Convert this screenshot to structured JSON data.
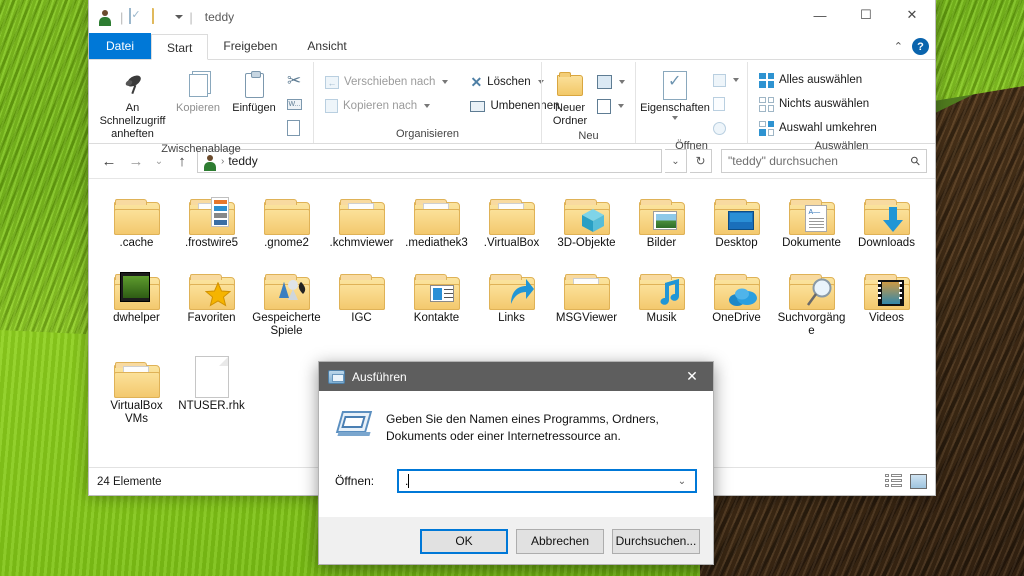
{
  "window": {
    "title": "teddy",
    "quick_access": [
      "user-account-icon",
      "properties-icon",
      "new-folder-icon",
      "customize-caret"
    ],
    "controls": {
      "minimize": "—",
      "maximize": "☐",
      "close": "✕",
      "collapse_ribbon": "⌃",
      "help": "?"
    }
  },
  "ribbon": {
    "tabs": [
      {
        "label": "Datei",
        "type": "file"
      },
      {
        "label": "Start",
        "type": "active"
      },
      {
        "label": "Freigeben",
        "type": "normal"
      },
      {
        "label": "Ansicht",
        "type": "normal"
      }
    ],
    "groups": [
      {
        "label": "Zwischenablage",
        "big": [
          {
            "label": "An Schnellzugriff\nanheften",
            "icon": "pin-icon",
            "dim": false
          },
          {
            "label": "Kopieren",
            "icon": "copy-icon",
            "dim": true
          },
          {
            "label": "Einfügen",
            "icon": "paste-icon",
            "dim": false
          }
        ],
        "small": [
          {
            "label": "",
            "icon": "cut-icon"
          },
          {
            "label": "",
            "icon": "copy-path-icon"
          },
          {
            "label": "",
            "icon": "paste-shortcut-icon"
          }
        ]
      },
      {
        "label": "Organisieren",
        "small": [
          {
            "label": "Verschieben nach",
            "icon": "move-to-icon",
            "dim": true,
            "caret": true
          },
          {
            "label": "Kopieren nach",
            "icon": "copy-to-icon",
            "dim": true,
            "caret": true
          },
          {
            "label": "Löschen",
            "icon": "delete-icon",
            "dim": false,
            "caret": true
          },
          {
            "label": "Umbenennen",
            "icon": "rename-icon",
            "dim": false,
            "caret": false
          }
        ]
      },
      {
        "label": "Neu",
        "big": [
          {
            "label": "Neuer\nOrdner",
            "icon": "new-folder-icon",
            "dim": false
          }
        ],
        "small": [
          {
            "label": "",
            "icon": "new-item-icon",
            "caret": true
          },
          {
            "label": "",
            "icon": "easy-access-icon",
            "caret": true
          }
        ]
      },
      {
        "label": "Öffnen",
        "big": [
          {
            "label": "Eigenschaften",
            "icon": "properties-icon",
            "dim": false,
            "caret": true
          }
        ],
        "small": [
          {
            "label": "",
            "icon": "open-with-icon",
            "caret": true
          },
          {
            "label": "",
            "icon": "edit-icon"
          },
          {
            "label": "",
            "icon": "history-icon"
          }
        ]
      },
      {
        "label": "Auswählen",
        "small": [
          {
            "label": "Alles auswählen",
            "icon": "select-all-icon",
            "dim": false
          },
          {
            "label": "Nichts auswählen",
            "icon": "select-none-icon",
            "dim": false
          },
          {
            "label": "Auswahl umkehren",
            "icon": "invert-selection-icon",
            "dim": false
          }
        ]
      }
    ]
  },
  "addressbar": {
    "back": "←",
    "forward": "→",
    "recent": "⌄",
    "up": "↑",
    "path": "teddy",
    "path_separator": "›",
    "dropdown": "⌄",
    "refresh": "↻"
  },
  "search": {
    "placeholder": "\"teddy\" durchsuchen",
    "icon": "search-icon"
  },
  "files": [
    {
      "name": ".cache",
      "type": "folder",
      "overlay": "none"
    },
    {
      "name": ".frostwire5",
      "type": "folder",
      "overlay": "preview"
    },
    {
      "name": ".gnome2",
      "type": "folder",
      "overlay": "none"
    },
    {
      "name": ".kchmviewer",
      "type": "folder",
      "overlay": "sheet"
    },
    {
      "name": ".mediathek3",
      "type": "folder",
      "overlay": "sheet"
    },
    {
      "name": ".VirtualBox",
      "type": "folder",
      "overlay": "sheet"
    },
    {
      "name": "3D-Objekte",
      "type": "folder",
      "overlay": "cube"
    },
    {
      "name": "Bilder",
      "type": "folder",
      "overlay": "picture"
    },
    {
      "name": "Desktop",
      "type": "folder",
      "overlay": "monitor"
    },
    {
      "name": "Dokumente",
      "type": "folder",
      "overlay": "document"
    },
    {
      "name": "Downloads",
      "type": "folder",
      "overlay": "arrow"
    },
    {
      "name": "dwhelper",
      "type": "folder",
      "overlay": "photo"
    },
    {
      "name": "Favoriten",
      "type": "folder",
      "overlay": "star"
    },
    {
      "name": "Gespeicherte Spiele",
      "type": "folder",
      "overlay": "games"
    },
    {
      "name": "IGC",
      "type": "folder",
      "overlay": "none"
    },
    {
      "name": "Kontakte",
      "type": "folder",
      "overlay": "contact"
    },
    {
      "name": "Links",
      "type": "folder",
      "overlay": "link"
    },
    {
      "name": "MSGViewer",
      "type": "folder",
      "overlay": "sheet"
    },
    {
      "name": "Musik",
      "type": "folder",
      "overlay": "note"
    },
    {
      "name": "OneDrive",
      "type": "folder",
      "overlay": "cloud"
    },
    {
      "name": "Suchvorgänge",
      "type": "folder",
      "overlay": "magnifier"
    },
    {
      "name": "Videos",
      "type": "folder",
      "overlay": "film"
    },
    {
      "name": "VirtualBox VMs",
      "type": "folder",
      "overlay": "sheet"
    },
    {
      "name": "NTUSER.rhk",
      "type": "file",
      "overlay": "none"
    }
  ],
  "statusbar": {
    "count": "24 Elemente",
    "views": [
      "details-view-icon",
      "large-icons-view-icon"
    ]
  },
  "run_dialog": {
    "title": "Ausführen",
    "close": "✕",
    "description": "Geben Sie den Namen eines Programms, Ordners, Dokuments oder einer Internetressource an.",
    "open_label": "Öffnen:",
    "open_value": ".",
    "dropdown": "⌄",
    "buttons": [
      {
        "label": "OK",
        "primary": true
      },
      {
        "label": "Abbrechen",
        "primary": false
      },
      {
        "label": "Durchsuchen...",
        "primary": false
      }
    ]
  },
  "theme": {
    "accent": "#0078d7",
    "file_tab": "#0078d7",
    "dialog_titlebar": "#5e5e5e",
    "folder_yellow": "#f6cf77"
  }
}
